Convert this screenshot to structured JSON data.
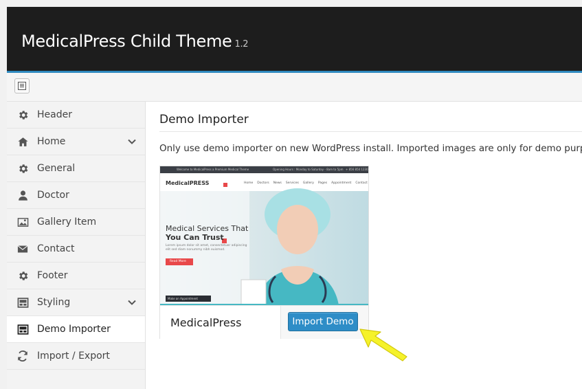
{
  "app": {
    "title": "MedicalPress Child Theme",
    "version": "1.2"
  },
  "toolbar": {
    "toggle_icon": "panel-layout-icon"
  },
  "sidebar": {
    "items": [
      {
        "label": "Header",
        "icon": "gear-icon"
      },
      {
        "label": "Home",
        "icon": "home-icon",
        "expandable": true
      },
      {
        "label": "General",
        "icon": "gear-icon"
      },
      {
        "label": "Doctor",
        "icon": "user-icon"
      },
      {
        "label": "Gallery Item",
        "icon": "image-icon"
      },
      {
        "label": "Contact",
        "icon": "envelope-icon"
      },
      {
        "label": "Footer",
        "icon": "gear-icon"
      },
      {
        "label": "Styling",
        "icon": "layout-icon",
        "expandable": true
      },
      {
        "label": "Demo Importer",
        "icon": "layout-icon",
        "active": true
      },
      {
        "label": "Import / Export",
        "icon": "refresh-icon"
      }
    ]
  },
  "main": {
    "title": "Demo Importer",
    "description": "Only use demo importer on new WordPress install. Imported images are only for demo purpose.",
    "demo": {
      "name": "MedicalPress",
      "button_label": "Import Demo",
      "preview": {
        "top_bar_text": "Welcome to MedicalPress a Premium Medical Theme",
        "top_bar_hours": "Opening Hours : Monday to Saturday - 8am to 5pm",
        "top_bar_phone": "+ 856 854 1230",
        "logo_text": "MedicalPRESS",
        "menu": [
          "Home",
          "Doctors",
          "News",
          "Services",
          "Gallery",
          "Pages",
          "Appointment",
          "Contact"
        ],
        "hero_title_line1": "Medical Services That",
        "hero_title_line2": "You Can Trust",
        "hero_body": "Lorem ipsum dolor sit amet, consectetuer adipiscing elit sed diam nonummy nibh euismod.",
        "hero_button": "Read More",
        "appointment_bar": "Make an Appointment"
      }
    }
  },
  "colors": {
    "accent": "#2e8dc7",
    "topbar": "#1d1d1d",
    "arrow": "#f5f22a"
  }
}
